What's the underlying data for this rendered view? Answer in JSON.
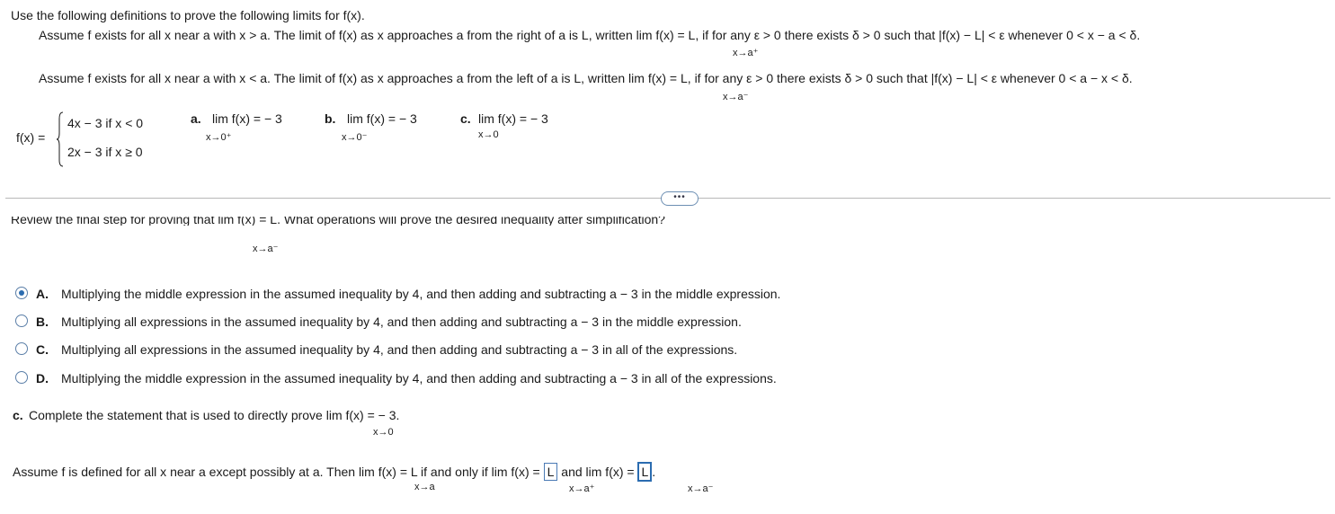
{
  "instructions": "Use the following definitions to prove the following limits for f(x).",
  "def_right": {
    "pre": "Assume f exists for all x near a with x > a. The limit of f(x) as x approaches a from the right of a is L, written  lim  f(x) = L, if for any ε > 0 there exists δ > 0  such that |f(x) − L| < ε whenever 0 < x − a < δ.",
    "sub": "x→a⁺"
  },
  "def_left": {
    "pre": "Assume f exists for all x near a with x < a. The limit of f(x) as x approaches a from the left of a is L, written  lim  f(x) = L, if for any ε > 0 there exists δ > 0 such that |f(x) − L| < ε whenever 0 < a − x < δ.",
    "sub": "x→a⁻"
  },
  "function": {
    "label": "f(x) =",
    "case1": "4x − 3  if x < 0",
    "case2": "2x − 3  if x ≥ 0"
  },
  "parts": {
    "a": {
      "letter": "a.",
      "expr": "lim  f(x) = − 3",
      "sub": "x→0⁺"
    },
    "b": {
      "letter": "b.",
      "expr": "lim  f(x) = − 3",
      "sub": "x→0⁻"
    },
    "c": {
      "letter": "c.",
      "expr": "lim  f(x) = − 3",
      "sub": "x→0"
    }
  },
  "more_button": "•••",
  "question": {
    "text": "Review the final step for proving that  lim  f(x) = L. What operations will prove the desired inequality after simplification?",
    "sub": "x→a⁻"
  },
  "options": [
    {
      "letter": "A.",
      "text": "Multiplying the middle expression in the assumed inequality by 4, and then adding and subtracting a  − 3 in the middle expression.",
      "selected": true
    },
    {
      "letter": "B.",
      "text": "Multiplying all expressions in the assumed inequality by 4, and then adding and subtracting a  − 3 in the middle expression.",
      "selected": false
    },
    {
      "letter": "C.",
      "text": "Multiplying all expressions in the assumed inequality by 4, and then adding and subtracting a  − 3 in all of the expressions.",
      "selected": false
    },
    {
      "letter": "D.",
      "text": "Multiplying the middle expression in the assumed inequality by 4, and then adding and subtracting a  − 3 in all of the expressions.",
      "selected": false
    }
  ],
  "part_c": {
    "letter": "c.",
    "text": "Complete the statement that is used to directly prove  lim  f(x) = − 3.",
    "sub": "x→0"
  },
  "statement": {
    "pre": "Assume f is defined for all x near a except possibly at a. Then  lim  f(x) = L if and only if   lim  f(x) =",
    "sub1": "x→a",
    "sub2": "x→a⁺",
    "answer1": "L",
    "mid": "and   lim  f(x) =",
    "sub3": "x→a⁻",
    "answer2": "L",
    "end": "."
  }
}
